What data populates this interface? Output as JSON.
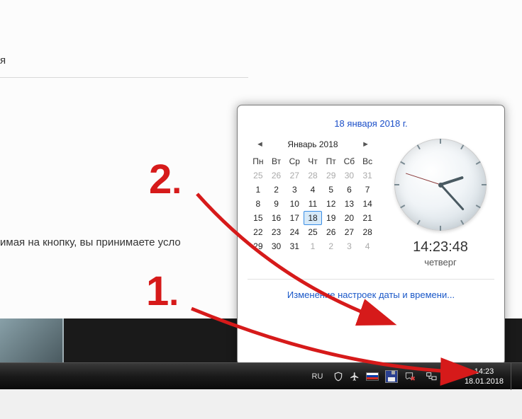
{
  "bg": {
    "frag1": "я",
    "frag2": "имая на кнопку, вы принимаете усло"
  },
  "popup": {
    "full_date": "18 января 2018 г.",
    "month_label": "Январь 2018",
    "dow": [
      "Пн",
      "Вт",
      "Ср",
      "Чт",
      "Пт",
      "Сб",
      "Вс"
    ],
    "prev_days": [
      25,
      26,
      27,
      28,
      29,
      30,
      31
    ],
    "days": [
      1,
      2,
      3,
      4,
      5,
      6,
      7,
      8,
      9,
      10,
      11,
      12,
      13,
      14,
      15,
      16,
      17,
      18,
      19,
      20,
      21,
      22,
      23,
      24,
      25,
      26,
      27,
      28,
      29,
      30,
      31
    ],
    "today": 18,
    "next_days": [
      1,
      2,
      3,
      4
    ],
    "digital_time": "14:23:48",
    "day_name": "четверг",
    "settings_link": "Изменение настроек даты и времени..."
  },
  "tray": {
    "lang": "RU",
    "time": "14:23",
    "date": "18.01.2018"
  },
  "annotations": {
    "one": "1",
    "two": "2",
    "dot": "."
  }
}
